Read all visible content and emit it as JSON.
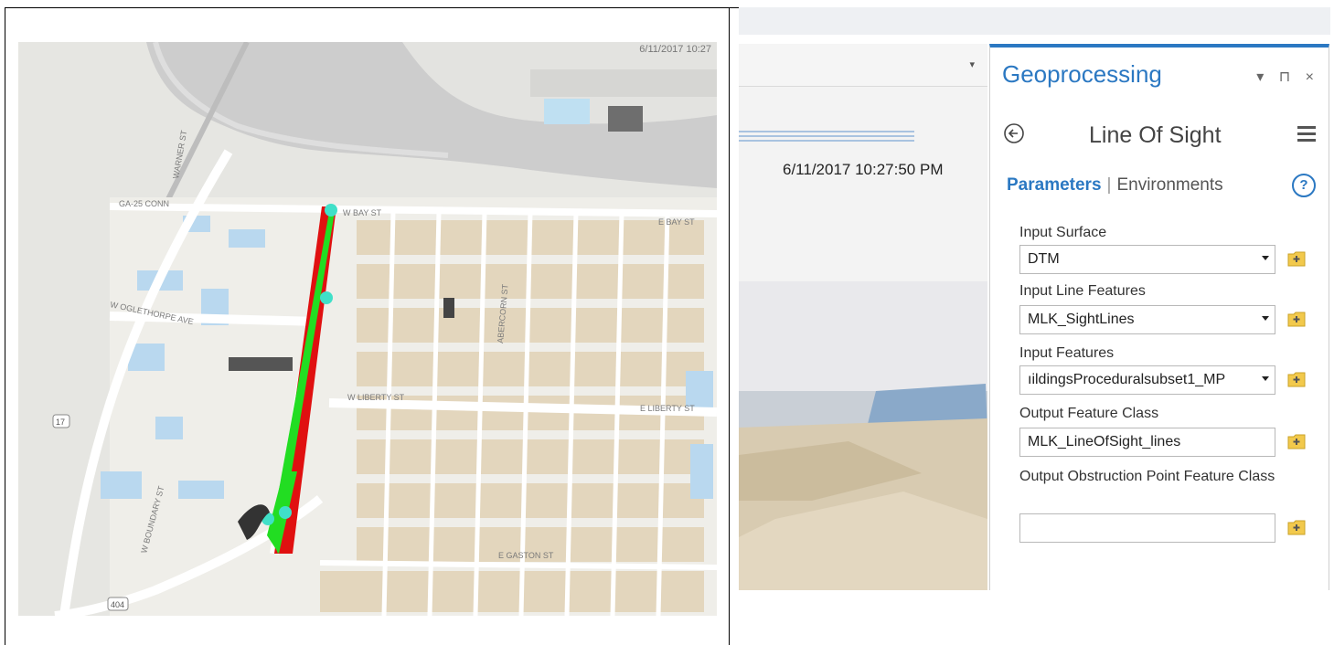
{
  "map": {
    "date_label": "6/11/2017 10:27",
    "street_labels": [
      "W BAY ST",
      "W OGLETHORPE AVE",
      "W LIBERTY ST",
      "E LIBERTY ST",
      "E GASTON ST",
      "GA-25 CONN",
      "WARNER ST",
      "W BOUNDARY ST",
      "E BAY ST",
      "ABERCORN ST",
      "E GASTON ST"
    ],
    "shield_labels": [
      "17",
      "404"
    ]
  },
  "scene": {
    "timestamp": "6/11/2017 10:27:50 PM",
    "dropdown_arrow": "▾"
  },
  "geoprocessing": {
    "title": "Geoprocessing",
    "window_controls": "▾ ⊓ ×",
    "tool_name": "Line Of Sight",
    "tabs": {
      "active": "Parameters",
      "separator": "|",
      "inactive": "Environments"
    },
    "help_symbol": "?",
    "params": [
      {
        "label": "Input Surface",
        "value": "DTM",
        "dropdown": true
      },
      {
        "label": "Input Line Features",
        "value": "MLK_SightLines",
        "dropdown": true
      },
      {
        "label": "Input Features",
        "value": "ıildingsProceduralsubset1_MP",
        "dropdown": true
      },
      {
        "label": "Output Feature Class",
        "value": "MLK_LineOfSight_lines",
        "dropdown": false
      },
      {
        "label": "Output Obstruction Point Feature Class",
        "value": "",
        "dropdown": false
      }
    ]
  },
  "colors": {
    "accent": "#2b78c2",
    "visible_green": "#22dd22",
    "obstructed_red": "#e01010",
    "observer_cyan": "#40e0c8"
  }
}
